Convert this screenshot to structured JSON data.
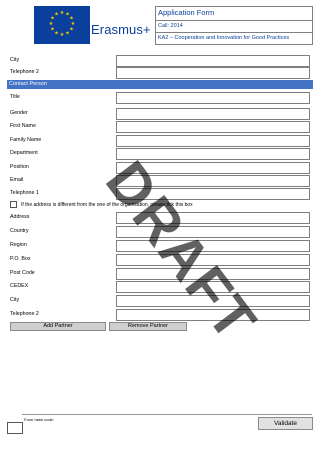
{
  "logo": {
    "program": "Erasmus+"
  },
  "header": {
    "title": "Application Form",
    "call": "Call: 2014",
    "action": "KA2 – Cooperation and Innovation for Good Practices"
  },
  "top_fields": [
    {
      "label": "City",
      "value": ""
    },
    {
      "label": "Telephone 2",
      "value": ""
    }
  ],
  "section": {
    "title": "Contact Person"
  },
  "contact_fields": [
    {
      "label": "Title",
      "value": ""
    },
    {
      "label": "Gender",
      "value": ""
    },
    {
      "label": "First Name",
      "value": ""
    },
    {
      "label": "Family Name",
      "value": ""
    },
    {
      "label": "Department",
      "value": ""
    },
    {
      "label": "Position",
      "value": ""
    },
    {
      "label": "Email",
      "value": ""
    },
    {
      "label": "Telephone 1",
      "value": ""
    }
  ],
  "address_checkbox": {
    "label": "If the address is different from the one of the organisation, please tick this box",
    "checked": false
  },
  "address_fields": [
    {
      "label": "Address",
      "value": ""
    },
    {
      "label": "Country",
      "value": ""
    },
    {
      "label": "Region",
      "value": ""
    },
    {
      "label": "P.O. Box",
      "value": ""
    },
    {
      "label": "Post Code",
      "value": ""
    },
    {
      "label": "CEDEX",
      "value": ""
    },
    {
      "label": "City",
      "value": ""
    },
    {
      "label": "Telephone 2",
      "value": ""
    }
  ],
  "buttons": {
    "add_partner": "Add Partner",
    "remove_partner": "Remove Partner",
    "validate": "Validate"
  },
  "footer": {
    "hash_label": "Form hash code:"
  },
  "watermark": "DRAFT",
  "colors": {
    "brand_blue": "#0a3f9c",
    "section_bar": "#4472c4",
    "stars": "#ffcc00"
  }
}
